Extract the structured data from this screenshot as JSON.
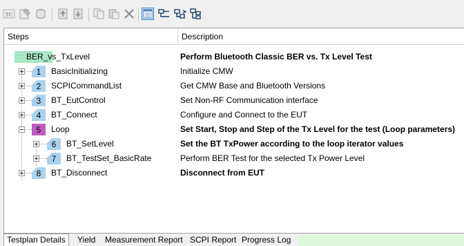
{
  "toolbar": {
    "buttons": [
      {
        "name": "tc-icon"
      },
      {
        "name": "properties-icon"
      },
      {
        "name": "database-icon"
      },
      {
        "name": "move-up-icon"
      },
      {
        "name": "move-down-icon"
      },
      {
        "name": "copy-icon"
      },
      {
        "name": "paste-icon"
      },
      {
        "name": "delete-icon"
      },
      {
        "name": "details-view-icon"
      },
      {
        "name": "collapse-all-icon"
      },
      {
        "name": "step-into-icon"
      },
      {
        "name": "expand-all-icon"
      }
    ]
  },
  "columns": {
    "steps": "Steps",
    "description": "Description"
  },
  "steps": [
    {
      "number": "",
      "name": "BER_vs_TxLevel",
      "description": "Perform Bluetooth Classic BER vs. Tx Level Test",
      "bold": true,
      "color": "#a8e6c4",
      "level": 0,
      "expander": "none"
    },
    {
      "number": "1",
      "name": "BasicInitializing",
      "description": "Initialize CMW",
      "bold": false,
      "color": "#aad2ee",
      "level": 1,
      "expander": "plus"
    },
    {
      "number": "2",
      "name": "SCPICommandList",
      "description": "Get CMW Base and Bluetooth Versions",
      "bold": false,
      "color": "#aad2ee",
      "level": 1,
      "expander": "plus"
    },
    {
      "number": "3",
      "name": "BT_EutControl",
      "description": "Set Non-RF Communication interface",
      "bold": false,
      "color": "#aad2ee",
      "level": 1,
      "expander": "plus"
    },
    {
      "number": "4",
      "name": "BT_Connect",
      "description": "Configure and Connect to the EUT",
      "bold": false,
      "color": "#aad2ee",
      "level": 1,
      "expander": "plus"
    },
    {
      "number": "5",
      "name": "Loop",
      "description": "Set Start, Stop and Step of the Tx Level for the test (Loop parameters)",
      "bold": true,
      "color": "#c05bc6",
      "level": 1,
      "expander": "minus"
    },
    {
      "number": "6",
      "name": "BT_SetLevel",
      "description": "Set the BT TxPower according to the loop iterator values",
      "bold": true,
      "color": "#aad2ee",
      "level": 2,
      "expander": "plus"
    },
    {
      "number": "7",
      "name": "BT_TestSet_BasicRate",
      "description": "Perform BER Test for the selected Tx Power Level",
      "bold": false,
      "color": "#aad2ee",
      "level": 2,
      "expander": "plus"
    },
    {
      "number": "8",
      "name": "BT_Disconnect",
      "description": "Disconnect from EUT",
      "bold": true,
      "color": "#aad2ee",
      "level": 1,
      "expander": "plus"
    }
  ],
  "tabs": [
    {
      "label": "Testplan Details",
      "active": true
    },
    {
      "label": "Yield",
      "active": false
    },
    {
      "label": "Measurement Report",
      "active": false
    },
    {
      "label": "SCPI Report",
      "active": false
    },
    {
      "label": "Progress Log",
      "active": false
    }
  ]
}
